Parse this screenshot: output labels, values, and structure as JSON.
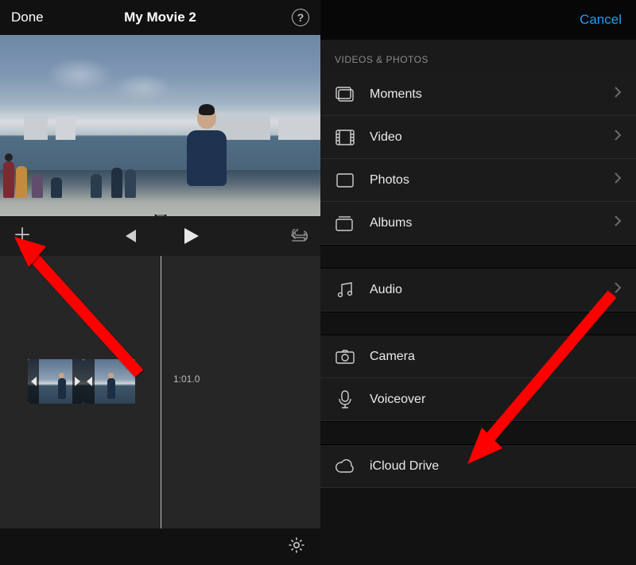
{
  "left": {
    "done": "Done",
    "title": "My Movie 2",
    "timecode": "1:01.0"
  },
  "right": {
    "cancel": "Cancel",
    "section_videos_photos": "VIDEOS & PHOTOS",
    "rows": {
      "moments": "Moments",
      "video": "Video",
      "photos": "Photos",
      "albums": "Albums",
      "audio": "Audio",
      "camera": "Camera",
      "voiceover": "Voiceover",
      "icloud": "iCloud Drive"
    }
  }
}
